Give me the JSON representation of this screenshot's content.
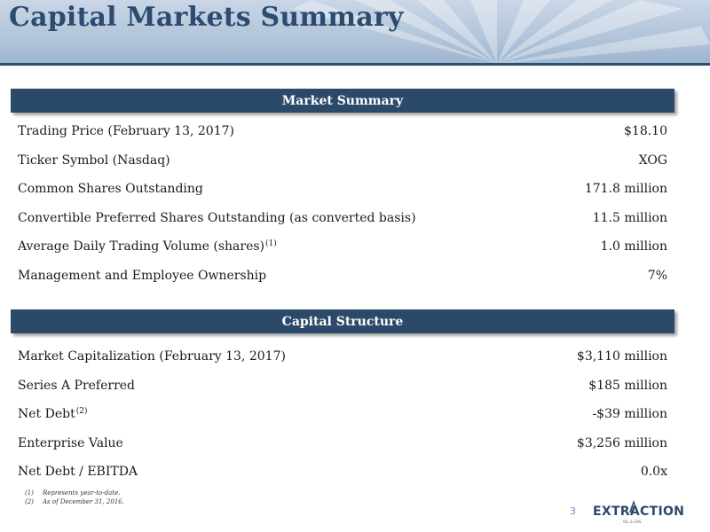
{
  "slide": {
    "title": "Capital Markets Summary",
    "page_number": "3"
  },
  "market_summary": {
    "header": "Market Summary",
    "rows": [
      {
        "label": "Trading Price (February 13, 2017)",
        "sup": "",
        "value": "$18.10"
      },
      {
        "label": "Ticker Symbol (Nasdaq)",
        "sup": "",
        "value": "XOG"
      },
      {
        "label": "Common Shares Outstanding",
        "sup": "",
        "value": "171.8 million"
      },
      {
        "label": "Convertible Preferred Shares Outstanding (as converted basis)",
        "sup": "",
        "value": "11.5 million"
      },
      {
        "label": "Average Daily Trading Volume (shares)",
        "sup": "(1)",
        "value": "1.0 million"
      },
      {
        "label": "Management and Employee Ownership",
        "sup": "",
        "value": "7%"
      }
    ]
  },
  "capital_structure": {
    "header": "Capital Structure",
    "rows": [
      {
        "label": "Market Capitalization (February 13, 2017)",
        "sup": "",
        "value": "$3,110 million"
      },
      {
        "label": "Series A Preferred",
        "sup": "",
        "value": "$185 million"
      },
      {
        "label": "Net Debt",
        "sup": "(2)",
        "value": "-$39 million"
      },
      {
        "label": "Enterprise Value",
        "sup": "",
        "value": "$3,256 million"
      },
      {
        "label": "Net Debt / EBITDA",
        "sup": "",
        "value": "0.0x"
      }
    ]
  },
  "footnotes": [
    {
      "num": "(1)",
      "text": "Represents year-to-date."
    },
    {
      "num": "(2)",
      "text": "As of December 31, 2016."
    }
  ],
  "logo": {
    "name": "EXTRACTION",
    "sub": "OIL & GAS",
    "icon": "oil-derrick-icon"
  },
  "colors": {
    "title": "#2b4b6f",
    "section_bar": "#2b4a6a",
    "banner_rule": "#2a4f77",
    "page_number": "#5a8fc0"
  }
}
